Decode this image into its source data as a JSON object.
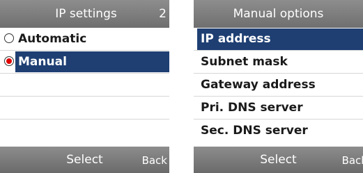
{
  "left_screen": {
    "title": "IP settings",
    "index": "2",
    "options": [
      {
        "label": "Automatic",
        "selected": false
      },
      {
        "label": "Manual",
        "selected": true
      }
    ],
    "softkeys": {
      "center": "Select",
      "right": "Back"
    }
  },
  "right_screen": {
    "title": "Manual options",
    "items": [
      {
        "label": "IP address",
        "selected": true
      },
      {
        "label": "Subnet mask",
        "selected": false
      },
      {
        "label": "Gateway address",
        "selected": false
      },
      {
        "label": "Pri. DNS server",
        "selected": false
      },
      {
        "label": "Sec. DNS server",
        "selected": false
      }
    ],
    "softkeys": {
      "center": "Select",
      "right": "Back"
    }
  },
  "colors": {
    "bar_gray": "#7d7d7d",
    "selection_blue": "#1f3f73",
    "radio_red": "#e00000"
  }
}
